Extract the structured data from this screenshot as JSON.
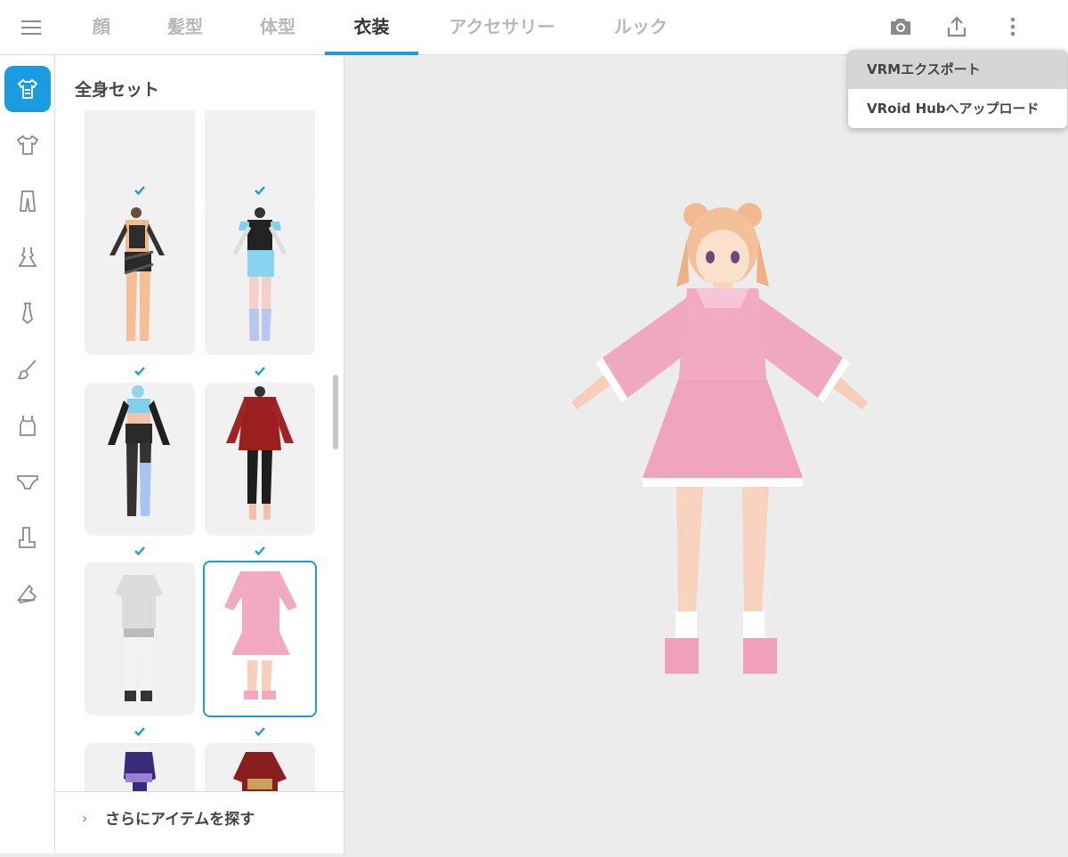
{
  "tabs": [
    {
      "label": "顔"
    },
    {
      "label": "髪型"
    },
    {
      "label": "体型"
    },
    {
      "label": "衣装"
    },
    {
      "label": "アクセサリー"
    },
    {
      "label": "ルック"
    }
  ],
  "active_tab": "衣装",
  "toolbar": {
    "icons": [
      "camera-icon",
      "share-upload-icon",
      "more-vertical-icon"
    ]
  },
  "menu": {
    "items": [
      {
        "label": "VRMエクスポート"
      },
      {
        "label": "VRoid Hubへアップロード"
      }
    ]
  },
  "rail": {
    "icons": [
      "full-outfit-icon",
      "tshirt-icon",
      "pants-icon",
      "dress-icon",
      "necktie-icon",
      "brush-icon",
      "tanktop-icon",
      "underwear-icon",
      "socks-icon",
      "shoes-icon"
    ]
  },
  "panel": {
    "title": "全身セット",
    "find_more": "さらにアイテムを探す"
  },
  "colors": {
    "accent": "#1a9ce0",
    "viewport_bg": "#ececec",
    "selected_outfit": "#f2a9c2"
  }
}
